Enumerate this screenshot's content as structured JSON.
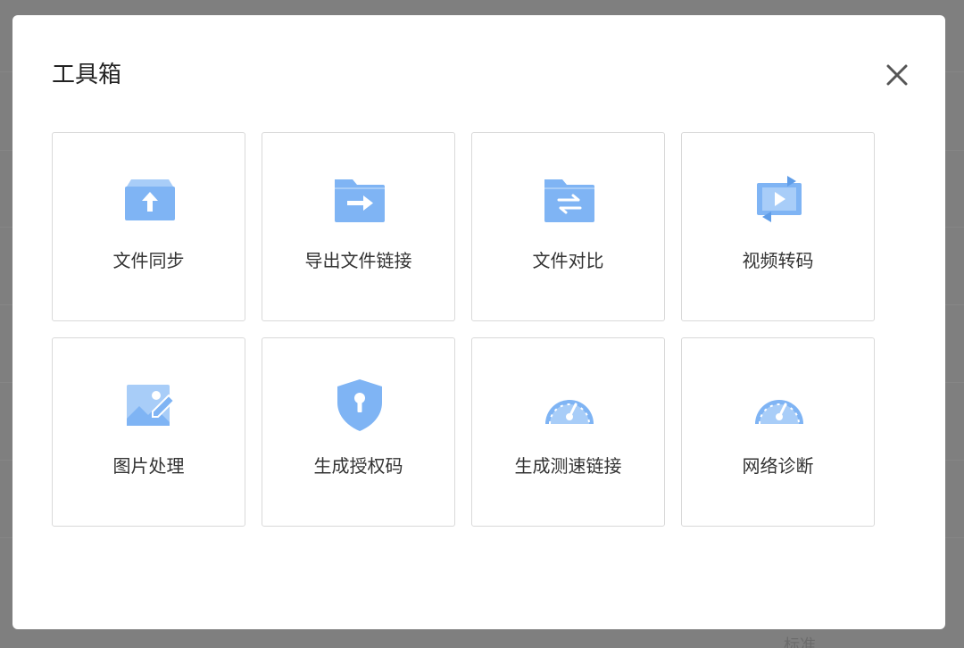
{
  "dialog": {
    "title": "工具箱",
    "close_icon": "close-icon"
  },
  "background": {
    "partial_text": "标准"
  },
  "colors": {
    "icon_primary": "#7fb4f4",
    "icon_light": "#a8cdf8",
    "icon_dark": "#5f9de8",
    "card_border": "#d9d9d9",
    "overlay": "#7f7f7f"
  },
  "tools": [
    {
      "label": "文件同步",
      "icon": "upload-box-icon"
    },
    {
      "label": "导出文件链接",
      "icon": "folder-export-icon"
    },
    {
      "label": "文件对比",
      "icon": "folder-compare-icon"
    },
    {
      "label": "视频转码",
      "icon": "video-convert-icon"
    },
    {
      "label": "图片处理",
      "icon": "image-edit-icon"
    },
    {
      "label": "生成授权码",
      "icon": "shield-key-icon"
    },
    {
      "label": "生成测速链接",
      "icon": "speedometer-icon"
    },
    {
      "label": "网络诊断",
      "icon": "network-gauge-icon"
    }
  ]
}
